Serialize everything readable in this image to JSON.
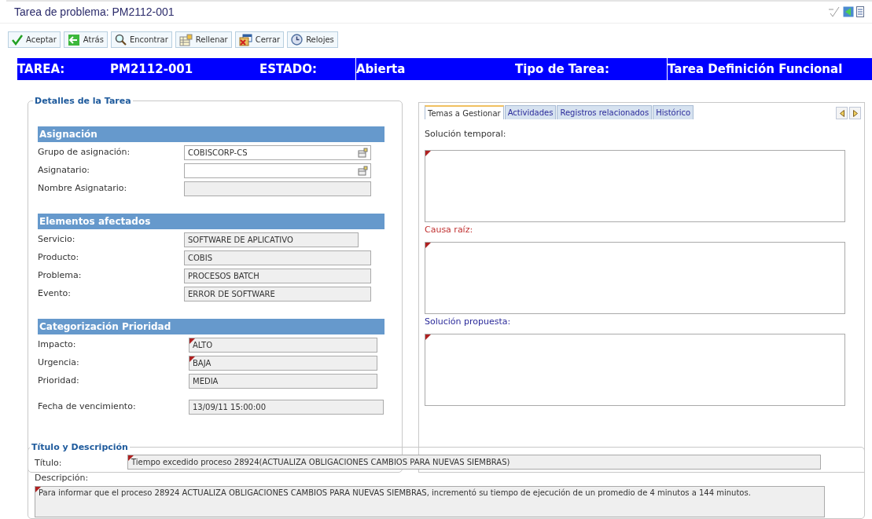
{
  "window": {
    "title": "Tarea de problema: PM2112-001"
  },
  "toolbar": [
    {
      "label": "Aceptar",
      "kind": "check"
    },
    {
      "label": "Atrás",
      "kind": "back"
    },
    {
      "label": "Encontrar",
      "kind": "search"
    },
    {
      "label": "Rellenar",
      "kind": "fill"
    },
    {
      "label": "Cerrar",
      "kind": "close"
    },
    {
      "label": "Relojes",
      "kind": "clock"
    }
  ],
  "banner": [
    {
      "label": "TAREA:",
      "value": "PM2112-001"
    },
    {
      "label": "ESTADO:",
      "value": "Abierta"
    },
    {
      "label": "Tipo de Tarea:",
      "value": "Tarea Definición Funcional"
    }
  ],
  "details": {
    "title": "Detalles de la Tarea",
    "sections": [
      {
        "title": "Asignación",
        "fields": [
          {
            "label": "Grupo de asignación:",
            "value": "COBISCORP-CS",
            "kind": "lookup",
            "required": false
          },
          {
            "label": "Asignatario:",
            "kind": "lookup",
            "required": false
          },
          {
            "label": "Nombre Asignatario:",
            "kind": "readonly",
            "required": false
          }
        ]
      },
      {
        "title": "Elementos afectados",
        "fields": [
          {
            "label": "Servicio:",
            "value": "SOFTWARE DE APLICATIVO",
            "kind": "readonly",
            "required": false
          },
          {
            "label": "Producto:",
            "value": "COBIS",
            "kind": "readonly",
            "required": false
          },
          {
            "label": "Problema:",
            "value": "PROCESOS BATCH",
            "kind": "readonly",
            "required": false
          },
          {
            "label": "Evento:",
            "value": "ERROR DE SOFTWARE",
            "kind": "readonly",
            "required": false
          }
        ]
      },
      {
        "title": "Categorización Prioridad",
        "fields": [
          {
            "label": "Impacto:",
            "value": "ALTO",
            "kind": "readonly",
            "required": true
          },
          {
            "label": "Urgencia:",
            "value": "BAJA",
            "kind": "readonly",
            "required": true
          },
          {
            "label": "Prioridad:",
            "value": "MEDIA",
            "kind": "readonly",
            "required": false
          },
          {
            "label": "Fecha de vencimiento:",
            "value": "13/09/11 15:00:00",
            "kind": "readonly",
            "required": false
          }
        ]
      }
    ]
  },
  "tabs": [
    {
      "label": "Temas a Gestionar",
      "selected": true
    },
    {
      "label": "Actividades",
      "selected": false
    },
    {
      "label": "Registros relacionados",
      "selected": false
    },
    {
      "label": "Histórico",
      "selected": false
    }
  ],
  "tab_fields": [
    {
      "label": "Solución temporal:",
      "color": "#333333",
      "required": true
    },
    {
      "label": "Causa raíz:",
      "color": "#c03030",
      "required": true
    },
    {
      "label": "Solución propuesta:",
      "color": "#2a2a9a",
      "required": true
    }
  ],
  "description": {
    "title": "Título y Descripción",
    "fields": [
      {
        "label": "Título:",
        "value": "Tiempo excedido  proceso 28924(ACTUALIZA OBLIGACIONES CAMBIOS PARA NUEVAS SIEMBRAS)",
        "required": true
      },
      {
        "label": "Descripción:",
        "value": "Para informar que el proceso 28924 ACTUALIZA OBLIGACIONES CAMBIOS PARA NUEVAS SIEMBRAS, incrementó su tiempo de ejecución de un promedio de 4 minutos a 144 minutos.",
        "required": true
      }
    ]
  }
}
